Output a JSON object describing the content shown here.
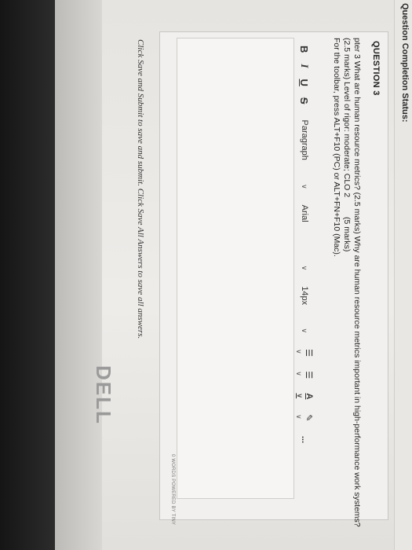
{
  "header": {
    "status_label": "Question Completion Status:"
  },
  "question": {
    "title": "QUESTION 3",
    "lines": [
      "pter 3 What are human resource metrics? (2.5 marks) Why are human resource metrics important in high-performance work systems?",
      "(2.5 marks) Level of rigor: moderate; CLO 2",
      "For the toolbar, press ALT+F10 (PC) or ALT+FN+F10 (Mac)."
    ],
    "marks_note": "(5 marks)"
  },
  "toolbar": {
    "bold": "B",
    "italic": "I",
    "underline": "U",
    "strike": "S",
    "paragraph": "Paragraph",
    "font": "Arial",
    "size": "14px",
    "bullets_icon": "bulleted-list-icon",
    "numbers_icon": "numbered-list-icon",
    "text_color": "A",
    "more": "..."
  },
  "editor": {
    "footer": "0 WORDS POWERED BY TINY"
  },
  "submit_note": "Click Save and Submit to save and submit. Click Save All Answers to save all answers.",
  "brand": "DELL"
}
